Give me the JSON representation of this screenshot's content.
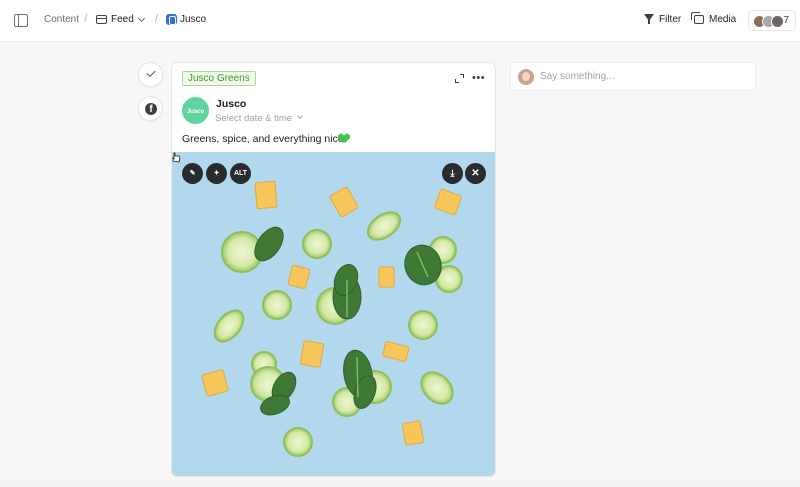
{
  "topbar": {
    "breadcrumbs": [
      "Content",
      "Feed",
      "Jusco"
    ],
    "separators": [
      "/",
      "/"
    ],
    "tools": {
      "filter_label": "Filter",
      "media_label": "Media"
    },
    "collaborators_count": "7"
  },
  "post": {
    "tag": "Jusco Greens",
    "account_name": "Jusco",
    "account_avatar_text": "Jusco",
    "date_placeholder": "Select date & time",
    "caption": "Greens, spice, and everything nice",
    "image_tools": {
      "alt_label": "ALT"
    }
  },
  "comment": {
    "placeholder": "Say something..."
  },
  "colors": {
    "accent": "#3b9a22",
    "tag_border": "#a6df8f",
    "photo_bg": "#b2d8ee"
  }
}
